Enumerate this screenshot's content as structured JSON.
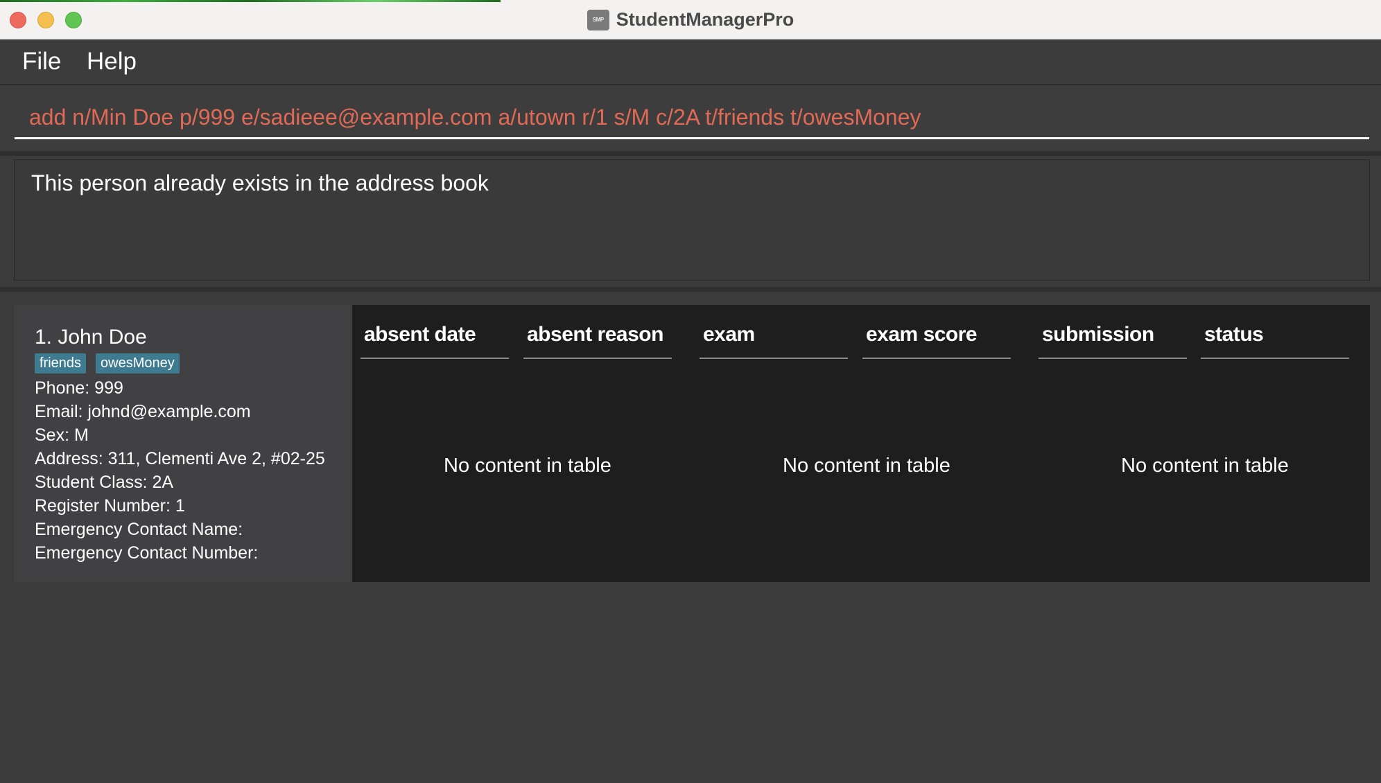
{
  "window": {
    "title": "StudentManagerPro",
    "icon_label": "SMP"
  },
  "menu": {
    "items": [
      "File",
      "Help"
    ]
  },
  "command": {
    "value": "add n/Min Doe p/999 e/sadieee@example.com a/utown r/1 s/M c/2A t/friends t/owesMoney",
    "text_color": "#e06a55"
  },
  "result": {
    "message": "This person already exists in the address book"
  },
  "person": {
    "name": "1. John Doe",
    "tags": [
      "friends",
      "owesMoney"
    ],
    "tag_color": "#3e7b91",
    "fields": [
      "Phone: 999",
      "Email: johnd@example.com",
      "Sex: M",
      "Address: 311, Clementi Ave 2, #02-25",
      "Student Class: 2A",
      "Register Number: 1",
      "Emergency Contact Name:",
      "Emergency Contact Number:"
    ]
  },
  "tables": [
    {
      "columns": [
        "absent date",
        "absent reason"
      ],
      "empty_text": "No content in table"
    },
    {
      "columns": [
        "exam",
        "exam score"
      ],
      "empty_text": "No content in table"
    },
    {
      "columns": [
        "submission",
        "status"
      ],
      "empty_text": "No content in table"
    }
  ]
}
